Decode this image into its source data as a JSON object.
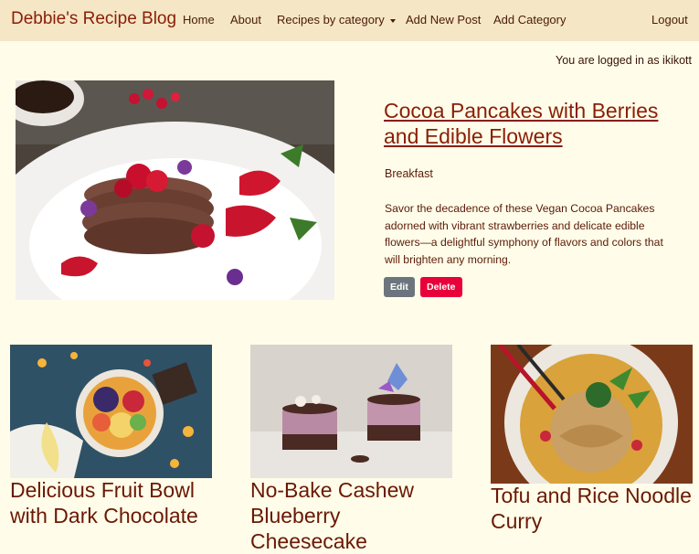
{
  "navbar": {
    "brand": "Debbie's Recipe Blog",
    "links": [
      "Home",
      "About",
      "Recipes by category",
      "Add New Post",
      "Add Category",
      "Logout"
    ]
  },
  "status": {
    "login_text": "You are logged in as ikikott"
  },
  "featured": {
    "title": "Cocoa Pancakes with Berries and Edible Flowers",
    "category": "Breakfast",
    "description": "Savor the decadence of these Vegan Cocoa Pancakes adorned with vibrant strawberries and delicate edible flowers—a delightful symphony of flavors and colors that will brighten any morning.",
    "edit_label": "Edit",
    "delete_label": "Delete"
  },
  "cards": [
    {
      "title": "Delicious Fruit Bowl with Dark Chocolate"
    },
    {
      "title": "No-Bake Cashew Blueberry Cheesecake"
    },
    {
      "title": "Tofu and Rice Noodle Curry"
    }
  ],
  "colors": {
    "navbar_bg": "#f5e6c6",
    "page_bg": "#fffde9",
    "brand": "#8a1e06",
    "edit_button": "#6c757d",
    "delete_button": "#e8003a"
  }
}
